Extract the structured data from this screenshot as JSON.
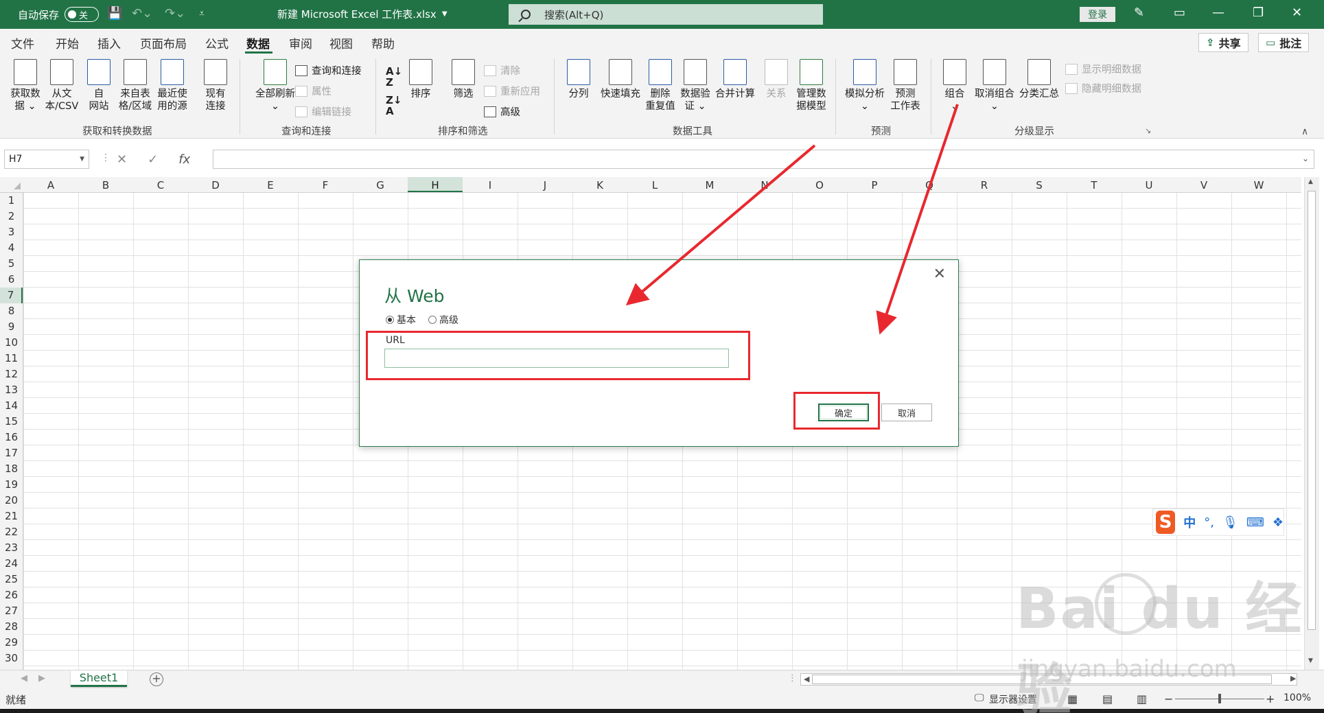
{
  "titlebar": {
    "autosave_label": "自动保存",
    "autosave_state": "关",
    "doc_title": "新建 Microsoft Excel 工作表.xlsx",
    "search_placeholder": "搜索(Alt+Q)",
    "login_label": "登录",
    "color": "#217346"
  },
  "ribbon_tabs": [
    "文件",
    "开始",
    "插入",
    "页面布局",
    "公式",
    "数据",
    "审阅",
    "视图",
    "帮助"
  ],
  "active_tab": "数据",
  "share_label": "共享",
  "comment_label": "批注",
  "ribbon": {
    "get_transform": {
      "buttons": [
        "获取数\n据 ⌄",
        "从文\n本/CSV",
        "自\n网站",
        "来自表\n格/区域",
        "最近使\n用的源",
        "现有\n连接"
      ],
      "group_label": "获取和转换数据"
    },
    "queries": {
      "refresh_all": "全部刷新\n⌄",
      "queries_connections": "查询和连接",
      "properties": "属性",
      "edit_links": "编辑链接",
      "group_label": "查询和连接"
    },
    "sort_filter": {
      "sort": "排序",
      "filter": "筛选",
      "clear": "清除",
      "reapply": "重新应用",
      "advanced": "高级",
      "group_label": "排序和筛选"
    },
    "data_tools": {
      "buttons": [
        "分列",
        "快速填充",
        "删除\n重复值",
        "数据验\n证 ⌄",
        "合并计算",
        "关系",
        "管理数\n据模型"
      ],
      "group_label": "数据工具"
    },
    "forecast": {
      "buttons": [
        "模拟分析\n⌄",
        "预测\n工作表"
      ],
      "group_label": "预测"
    },
    "outline": {
      "buttons": [
        "组合\n⌄",
        "取消组合\n⌄",
        "分类汇总"
      ],
      "show_detail": "显示明细数据",
      "hide_detail": "隐藏明细数据",
      "group_label": "分级显示"
    }
  },
  "formula_bar": {
    "name_box": "H7",
    "fx": "fx",
    "formula": ""
  },
  "columns": [
    "A",
    "B",
    "C",
    "D",
    "E",
    "F",
    "G",
    "H",
    "I",
    "J",
    "K",
    "L",
    "M",
    "N",
    "O",
    "P",
    "Q",
    "R",
    "S",
    "T",
    "U",
    "V",
    "W"
  ],
  "selected_column": "H",
  "rows": [
    "1",
    "2",
    "3",
    "4",
    "5",
    "6",
    "7",
    "8",
    "9",
    "10",
    "11",
    "12",
    "13",
    "14",
    "15",
    "16",
    "17",
    "18",
    "19",
    "20",
    "21",
    "22",
    "23",
    "24",
    "25",
    "26",
    "27",
    "28",
    "29",
    "30"
  ],
  "selected_row": "7",
  "sheet_tab": "Sheet1",
  "statusbar": {
    "status": "就绪",
    "display_settings": "显示器设置",
    "zoom": "100%"
  },
  "dialog": {
    "title": "从 Web",
    "radio_basic": "基本",
    "radio_advanced": "高级",
    "selected_mode": "基本",
    "url_label": "URL",
    "url_value": "",
    "ok_label": "确定",
    "cancel_label": "取消"
  },
  "annotation_color": "#e8282e",
  "ime": {
    "logo": "S",
    "mode": "中"
  },
  "watermark": {
    "main": "Bai du 经验",
    "sub": "jingyan.baidu.com"
  }
}
